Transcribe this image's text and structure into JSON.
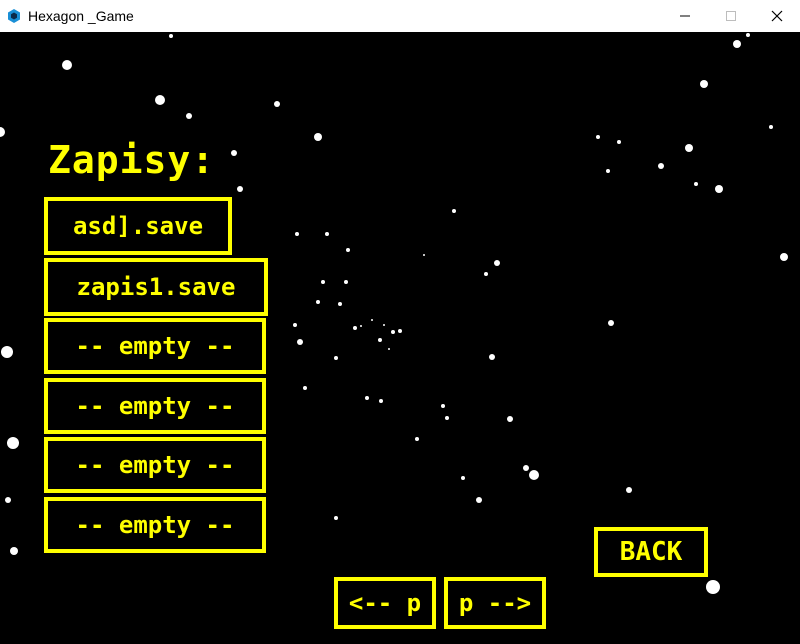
{
  "window": {
    "title": "Hexagon _Game",
    "controls": {
      "minimize": "—",
      "maximize": "☐",
      "close": "✕"
    },
    "app_icon": "hexagon-icon",
    "icon_color": "#1a8fd6"
  },
  "game": {
    "accent_color": "#ffff00",
    "background": "#000000",
    "heading": "Zapisy:",
    "save_slots": [
      {
        "label": "asd].save"
      },
      {
        "label": "zapis1.save"
      },
      {
        "label": "-- empty --"
      },
      {
        "label": "-- empty --"
      },
      {
        "label": "-- empty --"
      },
      {
        "label": "-- empty --"
      }
    ],
    "back_label": "BACK",
    "prev_page_label": "<-- p",
    "next_page_label": "p -->"
  }
}
